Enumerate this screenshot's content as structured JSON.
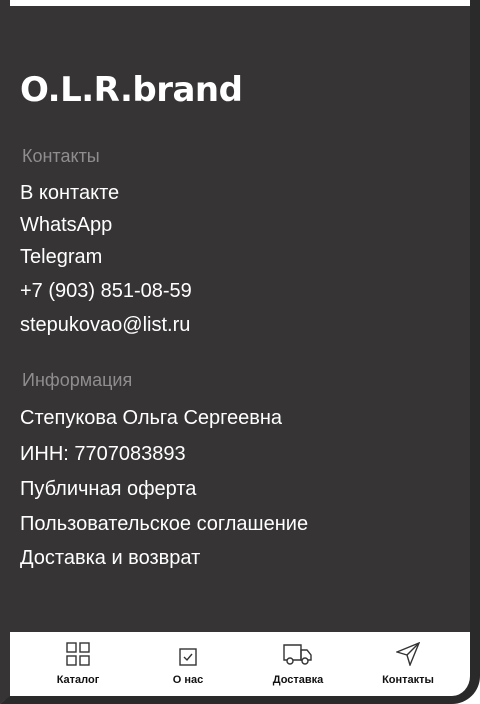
{
  "brand": "O.L.R.brand",
  "contacts": {
    "title": "Контакты",
    "items": [
      "В контакте",
      "WhatsApp",
      "Telegram",
      "+7 (903) 851-08-59",
      "stepukovao@list.ru"
    ]
  },
  "info": {
    "title": "Информация",
    "items": [
      "Степукова Ольга Сергеевна",
      "ИНН: 7707083893",
      "Публичная оферта",
      "Пользовательское соглашение",
      "Доставка и возврат"
    ]
  },
  "tabbar": {
    "tabs": [
      {
        "label": "Каталог",
        "icon": "grid-icon"
      },
      {
        "label": "О нас",
        "icon": "checkbox-icon"
      },
      {
        "label": "Доставка",
        "icon": "truck-icon"
      },
      {
        "label": "Контакты",
        "icon": "send-icon"
      }
    ]
  },
  "colors": {
    "background": "#363435",
    "text": "#ffffff",
    "muted": "#8f8d8e",
    "tabbar": "#ffffff"
  }
}
